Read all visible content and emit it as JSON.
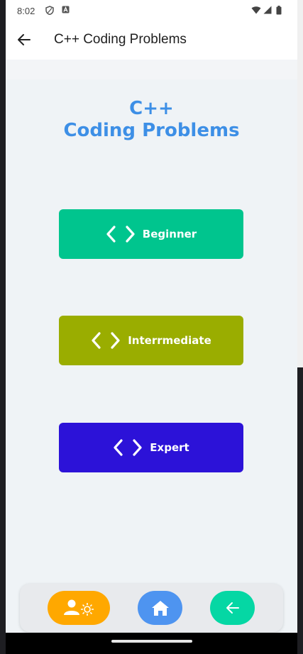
{
  "status": {
    "time": "8:02"
  },
  "app_bar": {
    "title": "C++ Coding Problems"
  },
  "heading": {
    "line1": "C++",
    "line2": "Coding Problems"
  },
  "levels": [
    {
      "label": "Beginner",
      "color": "#00c58e",
      "icon": "code-brackets-icon"
    },
    {
      "label": "Interrmediate",
      "color": "#9aad00",
      "icon": "code-brackets-icon"
    },
    {
      "label": "Expert",
      "color": "#2c12d8",
      "icon": "code-brackets-icon"
    }
  ],
  "bottom_nav": [
    {
      "icon": "profile-settings-icon",
      "color": "#ffa800"
    },
    {
      "icon": "home-icon",
      "color": "#4e94f0"
    },
    {
      "icon": "arrow-left-icon",
      "color": "#05d7a4"
    }
  ],
  "accent_color": "#3d8fe6"
}
